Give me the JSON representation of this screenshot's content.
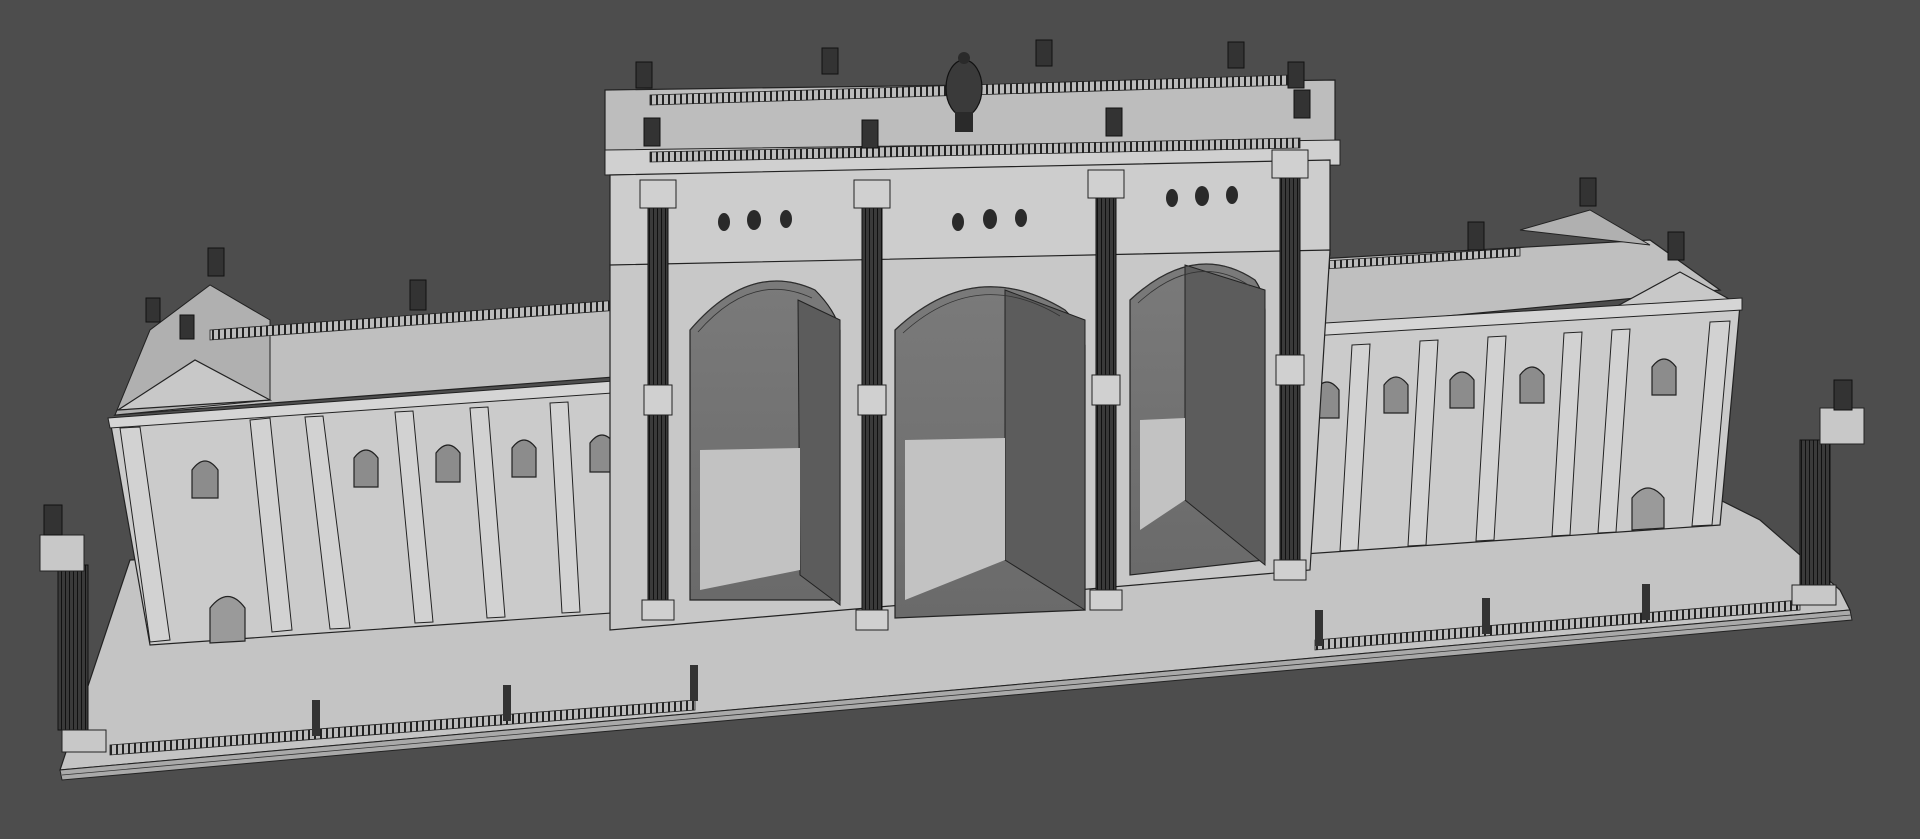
{
  "viewport": {
    "background": "#4d4d4d",
    "shading": "shaded-wireframe",
    "subject": "arch-gate-building"
  },
  "palette": {
    "wall": "#c9c9c9",
    "wall_dark": "#b4b4b4",
    "roof": "#bdbdbd",
    "plaza": "#c4c4c4",
    "opening": "#6e6e6e",
    "opening_dark": "#5c5c5c",
    "line": "#1e1e1e",
    "column": "#2a2a2a"
  }
}
